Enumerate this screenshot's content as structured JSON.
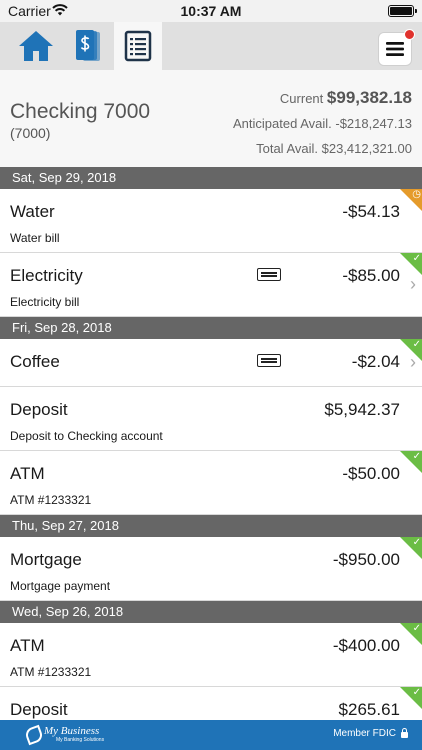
{
  "status_bar": {
    "carrier": "Carrier",
    "time": "10:37 AM"
  },
  "account": {
    "name": "Checking 7000",
    "number": "(7000)",
    "current_label": "Current",
    "current_value": "$99,382.18",
    "anticipated": "Anticipated Avail. -$218,247.13",
    "total": "Total Avail. $23,412,321.00"
  },
  "groups": [
    {
      "date": "Sat, Sep 29, 2018",
      "items": [
        {
          "name": "Water",
          "desc": "Water bill",
          "amount": "-$54.13",
          "status": "pending"
        },
        {
          "name": "Electricity",
          "desc": "Electricity bill",
          "amount": "-$85.00",
          "status": "cleared",
          "memo": true,
          "chevron": true
        }
      ]
    },
    {
      "date": "Fri, Sep 28, 2018",
      "items": [
        {
          "name": "Coffee",
          "desc": "",
          "amount": "-$2.04",
          "status": "cleared",
          "memo": true,
          "chevron": true
        },
        {
          "name": "Deposit",
          "desc": "Deposit to Checking account",
          "amount": "$5,942.37",
          "status": "cleared"
        },
        {
          "name": "ATM",
          "desc": "ATM #1233321",
          "amount": "-$50.00",
          "status": "cleared"
        }
      ]
    },
    {
      "date": "Thu, Sep 27, 2018",
      "items": [
        {
          "name": "Mortgage",
          "desc": "Mortgage payment",
          "amount": "-$950.00",
          "status": "cleared"
        }
      ]
    },
    {
      "date": "Wed, Sep 26, 2018",
      "items": [
        {
          "name": "ATM",
          "desc": "ATM #1233321",
          "amount": "-$400.00",
          "status": "cleared"
        },
        {
          "name": "Deposit",
          "desc": "",
          "amount": "$265.61",
          "status": "cleared"
        }
      ]
    }
  ],
  "footer": {
    "brand": "My Business",
    "tagline": "My Banking Solutions",
    "fdic": "Member FDIC"
  },
  "colors": {
    "tab_blue": "#1f73b7",
    "cleared": "#6bbd45",
    "pending": "#e59b2b",
    "date_header": "#666666",
    "footer": "#1f73b7"
  },
  "icons": {
    "home": "home-icon",
    "transfers": "dollar-cards-icon",
    "accounts": "statement-icon",
    "menu": "hamburger-menu-icon"
  }
}
